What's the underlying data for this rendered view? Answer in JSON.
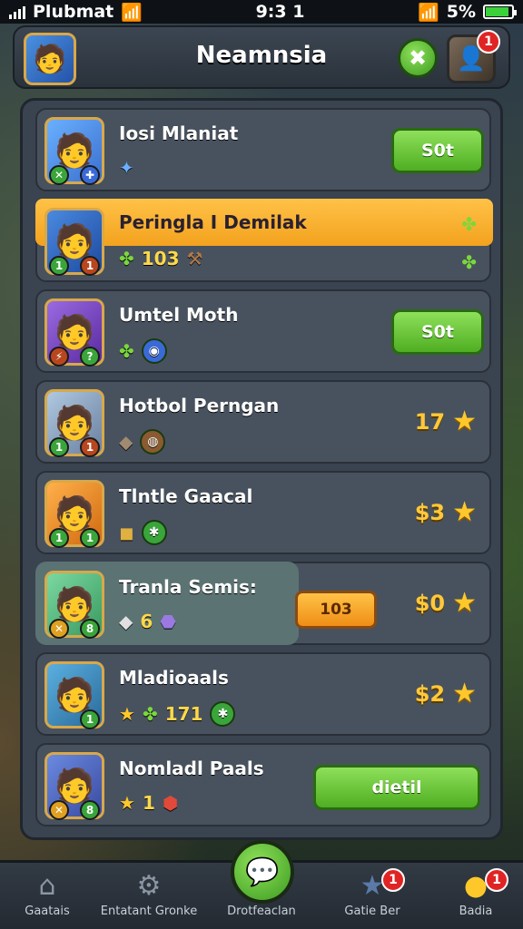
{
  "status_bar": {
    "carrier": "Plubmat",
    "time": "9:3 1",
    "battery": "5%"
  },
  "header": {
    "title": "Neamnsia",
    "close_icon": "✖",
    "profile_badge": "1"
  },
  "rows": [
    {
      "name": "Iosi Mlaniat",
      "items": [
        "✦"
      ],
      "count": "",
      "action": {
        "type": "button",
        "label": "S0t"
      }
    },
    {
      "name": "Peringla I Demilak",
      "items": [
        "✤"
      ],
      "count": "103",
      "action": {
        "type": "icons"
      }
    },
    {
      "name": "Umtel Moth",
      "items": [
        "✤"
      ],
      "count": "",
      "action": {
        "type": "button",
        "label": "S0t"
      }
    },
    {
      "name": "Hotbol Perngan",
      "items": [],
      "count": "",
      "action": {
        "type": "price",
        "value": "17"
      }
    },
    {
      "name": "Tlntle Gaacal",
      "items": [],
      "count": "",
      "action": {
        "type": "price",
        "value": "$3"
      }
    },
    {
      "name": "Tranla Semis:",
      "items": [],
      "count": "6",
      "action": {
        "type": "price",
        "value": "$0",
        "button": "103"
      }
    },
    {
      "name": "Mladioaals",
      "items": [],
      "count": "171",
      "action": {
        "type": "price",
        "value": "$2"
      }
    },
    {
      "name": "Nomladl Paals",
      "items": [],
      "count": "1",
      "action": {
        "type": "button",
        "label": "dietil"
      }
    }
  ],
  "nav": [
    {
      "label": "Gaatais"
    },
    {
      "label": "Entatant Gronke"
    },
    {
      "label": "Drotfeaclan"
    },
    {
      "label": "Gatie Ber",
      "badge": "1"
    },
    {
      "label": "Badia",
      "badge": "1"
    }
  ],
  "colors": {
    "accent_green": "#4fae22",
    "accent_orange": "#f3a21e",
    "badge_red": "#e02424"
  }
}
